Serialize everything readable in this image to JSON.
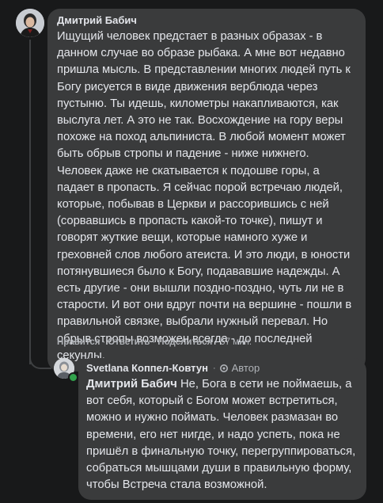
{
  "comment": {
    "author": "Дмитрий Бабич",
    "text": "Ищущий человек предстает в разных образах - в данном случае во образе рыбака. А мне вот недавно пришла мысль. В представлении многих людей путь к Богу рисуется в виде движения верблюда через пустыню. Ты идешь, километры накапливаются, как выслуга лет. А это не так. Восхождение на гору веры похоже на поход альпиниста. В любой момент может быть обрыв стропы и падение - ниже нижнего. Человек даже не скатывается к подошве горы, а падает в пропасть. Я сейчас порой встречаю людей, которые, побывав в Церкви и рассорившись с ней (сорвавшись в пропасть какой-то точке), пишут и говорят жуткие вещи, которые намного хуже и греховней слов любого атеиста. И это люди, в юности потянувшиеся было к Богу, подававшие надежды. А есть другие - они вышли поздно-поздно, чуть ли не в старости. И вот они вдруг почти на вершине - пошли в правильной связке, выбрали нужный перевал. Но обрыв стропы возможен всегда - до последней секунды.",
    "actions": {
      "like": "Нравится",
      "reply": "Ответить",
      "share": "Поделиться",
      "time": "57 мин."
    }
  },
  "reply": {
    "author": "Svetlana Коппел-Ковтун",
    "badge": "Автор",
    "mention": "Дмитрий Бабич",
    "text": " Не, Бога в сети не поймаешь, а вот себя, который с Богом может встретиться, можно и нужно поймать. Человек размазан во времени, его нет нигде, и надо успеть, пока не пришёл в финальную точку, перегруппироваться, собраться мышцами души в правильную форму, чтобы Встреча стала возможной."
  },
  "colors": {
    "background": "#18191a",
    "bubble": "#3a3b3c",
    "text": "#e4e6eb",
    "secondary": "#b0b3b8",
    "online": "#31a24c"
  },
  "icons": {
    "author_badge": "gear-icon",
    "presence": "online-dot-icon"
  }
}
